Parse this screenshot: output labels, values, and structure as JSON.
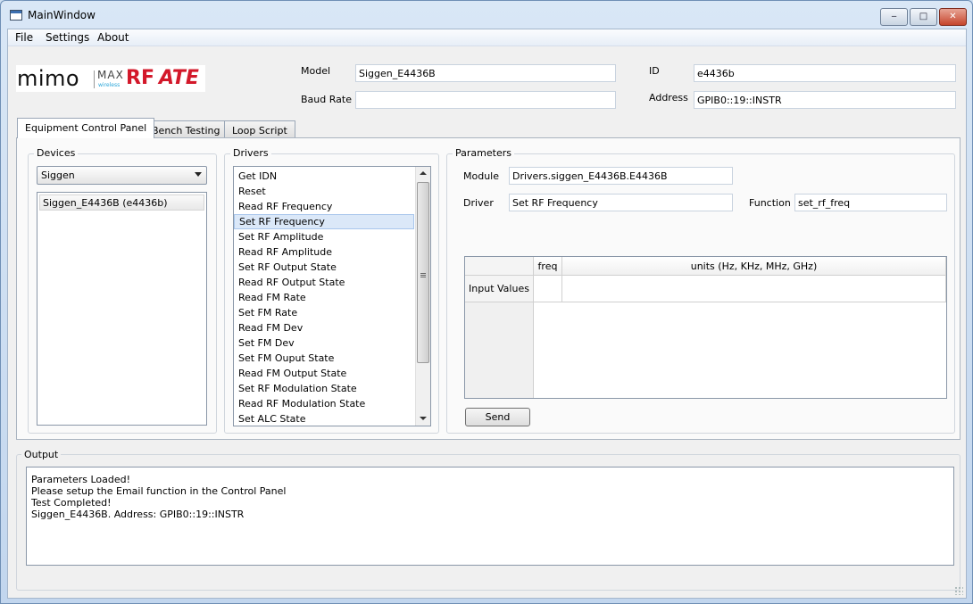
{
  "window": {
    "title": "MainWindow",
    "controls": {
      "minimize": "‒",
      "maximize": "□",
      "close": "✕"
    }
  },
  "menu": [
    "File",
    "Settings",
    "About"
  ],
  "logo": {
    "mimo": "mimo",
    "max": "MAX",
    "wireless": "wireless",
    "rf": "RF",
    "ate": "ATE"
  },
  "header": {
    "model_label": "Model",
    "model_value": "Siggen_E4436B",
    "baud_label": "Baud Rate",
    "baud_value": "",
    "id_label": "ID",
    "id_value": "e4436b",
    "address_label": "Address",
    "address_value": "GPIB0::19::INSTR"
  },
  "tabs": [
    "Equipment Control Panel",
    "Bench Testing",
    "Loop Script"
  ],
  "devices": {
    "title": "Devices",
    "selected": "Siggen",
    "items": [
      "Siggen_E4436B (e4436b)"
    ]
  },
  "drivers": {
    "title": "Drivers",
    "selected_index": 3,
    "items": [
      "Get IDN",
      "Reset",
      "Read RF Frequency",
      "Set RF Frequency",
      "Set RF Amplitude",
      "Read RF Amplitude",
      "Set RF Output State",
      "Read RF Output State",
      "Read FM Rate",
      "Set FM Rate",
      "Read FM Dev",
      "Set FM Dev",
      "Set FM Ouput State",
      "Read FM Output State",
      "Set RF Modulation State",
      "Read RF Modulation State",
      "Set ALC State"
    ]
  },
  "parameters": {
    "title": "Parameters",
    "module_label": "Module",
    "module_value": "Drivers.siggen_E4436B.E4436B",
    "driver_label": "Driver",
    "driver_value": "Set RF Frequency",
    "function_label": "Function",
    "function_value": "set_rf_freq",
    "table": {
      "columns": [
        "freq",
        "units (Hz, KHz, MHz, GHz)"
      ],
      "row_header": "Input Values"
    },
    "send_label": "Send"
  },
  "output": {
    "title": "Output",
    "lines": [
      "Parameters Loaded!",
      "Please setup the Email function in the Control Panel",
      "Test Completed!",
      "Siggen_E4436B. Address: GPIB0::19::INSTR"
    ]
  }
}
